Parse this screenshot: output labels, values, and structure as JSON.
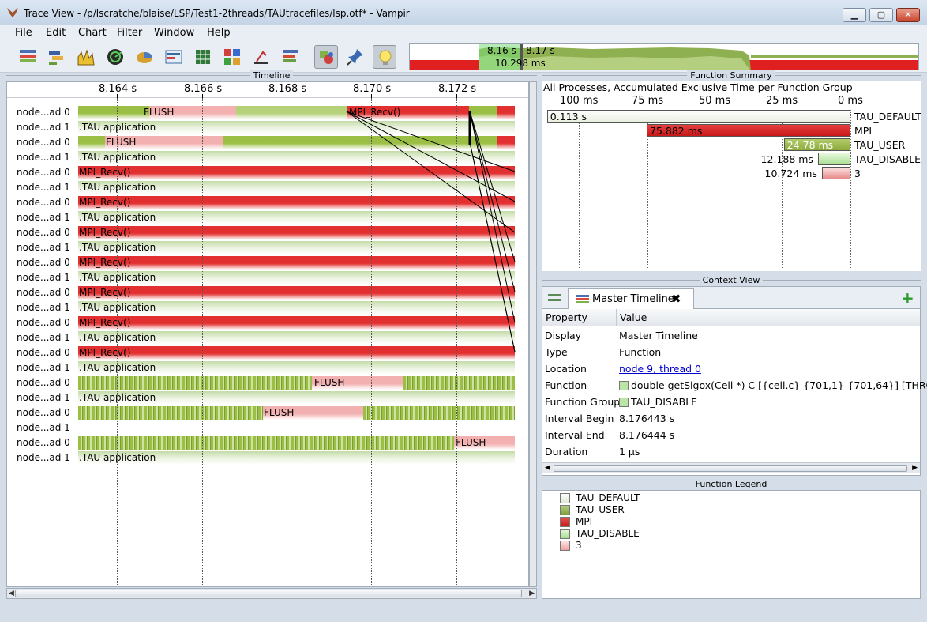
{
  "window": {
    "title": "Trace View - /p/lscratche/blaise/LSP/Test1-2threads/TAUtracefiles/lsp.otf* - Vampir",
    "minimize": "▁",
    "maximize": "▢",
    "close": "✕"
  },
  "menu": [
    "File",
    "Edit",
    "Chart",
    "Filter",
    "Window",
    "Help"
  ],
  "toolbar": {
    "icons": [
      "master-timeline-icon",
      "process-timeline-icon",
      "counter-timeline-icon",
      "performance-radar-icon",
      "function-summary-icon",
      "message-summary-icon",
      "communication-matrix-icon",
      "io-events-icon",
      "call-tree-icon",
      "process-summary-icon",
      "zoom-select-icon",
      "pin-icon",
      "lightbulb-icon"
    ],
    "mini_timeline": {
      "left_time": "8.16 s",
      "right_time": "8.17 s",
      "duration": "10.298 ms"
    }
  },
  "timeline": {
    "title": "Timeline",
    "ticks": [
      "8.164 s",
      "8.166 s",
      "8.168 s",
      "8.170 s",
      "8.172 s"
    ],
    "rows": [
      {
        "label": "node...ad 0",
        "bar": "FLUSH",
        "bar2": "MPI_Recv()"
      },
      {
        "label": "node...ad 1",
        "bar": ".TAU application"
      },
      {
        "label": "node...ad 0",
        "bar": "FLUSH"
      },
      {
        "label": "node...ad 1",
        "bar": ".TAU application"
      },
      {
        "label": "node...ad 0",
        "bar": "MPI_Recv()"
      },
      {
        "label": "node...ad 1",
        "bar": ".TAU application"
      },
      {
        "label": "node...ad 0",
        "bar": "MPI_Recv()"
      },
      {
        "label": "node...ad 1",
        "bar": ".TAU application"
      },
      {
        "label": "node...ad 0",
        "bar": "MPI_Recv()"
      },
      {
        "label": "node...ad 1",
        "bar": ".TAU application"
      },
      {
        "label": "node...ad 0",
        "bar": "MPI_Recv()"
      },
      {
        "label": "node...ad 1",
        "bar": ".TAU application"
      },
      {
        "label": "node...ad 0",
        "bar": "MPI_Recv()"
      },
      {
        "label": "node...ad 1",
        "bar": ".TAU application"
      },
      {
        "label": "node...ad 0",
        "bar": "MPI_Recv()"
      },
      {
        "label": "node...ad 1",
        "bar": ".TAU application"
      },
      {
        "label": "node...ad 0",
        "bar": "MPI_Recv()"
      },
      {
        "label": "node...ad 1",
        "bar": ".TAU application"
      },
      {
        "label": "node...ad 0",
        "bar": "FLUSH"
      },
      {
        "label": "node...ad 1",
        "bar": ".TAU application"
      },
      {
        "label": "node...ad 0",
        "bar": "FLUSH"
      },
      {
        "label": "node...ad 1",
        "bar": ""
      },
      {
        "label": "node...ad 0",
        "bar": "FLUSH"
      },
      {
        "label": "node...ad 1",
        "bar": ".TAU application"
      }
    ]
  },
  "function_summary": {
    "title": "Function Summary",
    "subtitle": "All Processes, Accumulated Exclusive Time per Function Group",
    "ticks": [
      "100 ms",
      "75 ms",
      "50 ms",
      "25 ms",
      "0 ms"
    ],
    "groups": [
      {
        "name": "TAU_DEFAULT",
        "value": "0.113 s",
        "ms": 113
      },
      {
        "name": "MPI",
        "value": "75.882 ms",
        "ms": 75.882
      },
      {
        "name": "TAU_USER",
        "value": "24.78 ms",
        "ms": 24.78
      },
      {
        "name": "TAU_DISABLE",
        "value": "12.188 ms",
        "ms": 12.188
      },
      {
        "name": "3",
        "value": "10.724 ms",
        "ms": 10.724
      }
    ]
  },
  "context_view": {
    "title": "Context View",
    "tab_label": "Master Timeline",
    "headers": {
      "property": "Property",
      "value": "Value"
    },
    "rows": [
      {
        "property": "Display",
        "value": "Master Timeline"
      },
      {
        "property": "Type",
        "value": "Function"
      },
      {
        "property": "Location",
        "value": "node 9, thread 0"
      },
      {
        "property": "Function",
        "value": "double getSigox(Cell *) C [{cell.c} {701,1}-{701,64}] [THRO"
      },
      {
        "property": "Function Group",
        "value": "TAU_DISABLE"
      },
      {
        "property": "Interval Begin",
        "value": "8.176443 s"
      },
      {
        "property": "Interval End",
        "value": "8.176444 s"
      },
      {
        "property": "Duration",
        "value": "1 µs"
      }
    ]
  },
  "function_legend": {
    "title": "Function Legend",
    "items": [
      "TAU_DEFAULT",
      "TAU_USER",
      "MPI",
      "TAU_DISABLE",
      "3"
    ]
  },
  "colors": {
    "mpi": "#e23030",
    "tau_user": "#9bbf45",
    "tau_default": "#dfe8d4",
    "tau_disable": "#b9e6a3",
    "group3": "#f3b3b3",
    "flush": "#f2b0b0"
  }
}
